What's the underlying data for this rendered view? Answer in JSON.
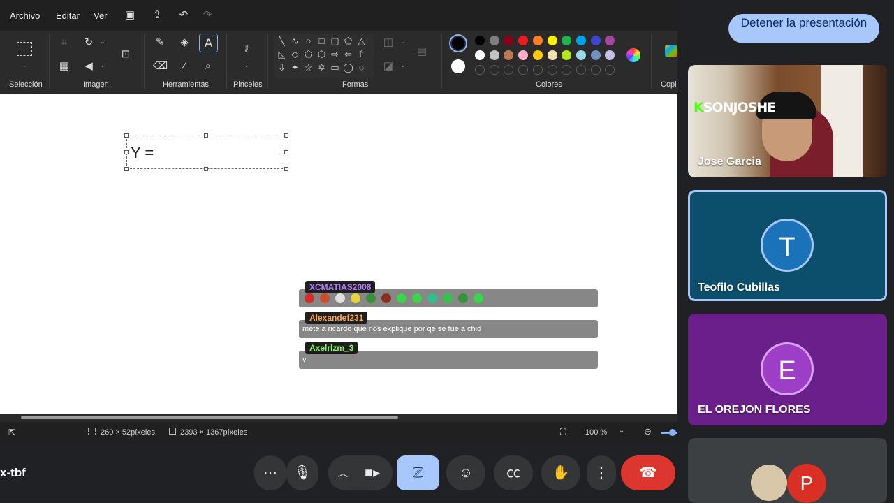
{
  "paint": {
    "menu": [
      "Archivo",
      "Editar",
      "Ver"
    ],
    "groups": {
      "seleccion": "Selección",
      "imagen": "Imagen",
      "herramientas": "Herramientas",
      "pinceles": "Pinceles",
      "formas": "Formas",
      "colores": "Colores",
      "copilot": "Copil"
    },
    "colors_row1": [
      "#000000",
      "#7f7f7f",
      "#880015",
      "#ed1c24",
      "#ff7f27",
      "#fff200",
      "#22b14c",
      "#00a2e8",
      "#3f48cc",
      "#a349a4"
    ],
    "colors_row2": [
      "#ffffff",
      "#c3c3c3",
      "#b97a57",
      "#ffaec9",
      "#ffc90e",
      "#efe4b0",
      "#b5e61d",
      "#99d9ea",
      "#7092be",
      "#c8bfe7"
    ],
    "primary_color": "#000000",
    "secondary_color": "#ffffff",
    "canvas_text": "Y =",
    "status": {
      "selection_size": "260 × 52píxeles",
      "canvas_size": "2393 × 1367píxeles",
      "zoom": "100 %"
    }
  },
  "chat": [
    {
      "user": "XCMATIAS2008",
      "user_color": "#b57cff",
      "message": ""
    },
    {
      "user": "Alexandef231",
      "user_color": "#ff9f40",
      "message": "mete a ricardo que nos explique por qe se fue a chid"
    },
    {
      "user": "Axelrlzm_3",
      "user_color": "#7cff4f",
      "message": "v"
    }
  ],
  "meet": {
    "stop_presenting": "Detener la presentación",
    "participants": [
      {
        "name": "Jose Garcia",
        "overlay_logo": "SONJOSHE"
      },
      {
        "name": "Teofilo Cubillas",
        "initial": "T",
        "bg": "#0b4f6c",
        "avatar_color": "#1a73b8"
      },
      {
        "name": "EL OREJON FLORES",
        "initial": "E",
        "bg": "#6b1f8a",
        "avatar_color": "#9d3ec7"
      },
      {
        "name": "",
        "initial": "P",
        "avatar_color": "#d93025"
      }
    ],
    "meeting_code": "x-tbf"
  }
}
